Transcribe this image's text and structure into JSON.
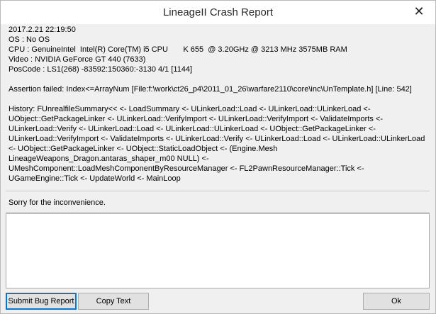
{
  "window": {
    "title": "LineageII Crash Report",
    "close_glyph": "✕"
  },
  "report": {
    "lines_top": [
      "2017.2.21 22:19:50",
      "OS : No OS",
      "CPU : GenuineIntel  Intel(R) Core(TM) i5 CPU       K 655  @ 3.20GHz @ 3213 MHz 3575MB RAM",
      "Video : NVIDIA GeForce GT 440 (7633)",
      "PosCode : LS1(268) -83592:150360:-3130 4/1 [1144]"
    ],
    "assertion": "Assertion failed: Index<=ArrayNum [File:f:\\work\\ct26_p4\\2011_01_26\\warfare2110\\core\\inc\\UnTemplate.h] [Line: 542]",
    "history": "History: FUnrealfileSummary<< <- LoadSummary <- ULinkerLoad::Load <- ULinkerLoad::ULinkerLoad <- UObject::GetPackageLinker <- ULinkerLoad::VerifyImport <- ULinkerLoad::VerifyImport <- ValidateImports <- ULinkerLoad::Verify <- ULinkerLoad::Load <- ULinkerLoad::ULinkerLoad <- UObject::GetPackageLinker <- ULinkerLoad::VerifyImport <- ValidateImports <- ULinkerLoad::Verify <- ULinkerLoad::Load <- ULinkerLoad::ULinkerLoad <- UObject::GetPackageLinker <- UObject::StaticLoadObject <- (Engine.Mesh LineageWeapons_Dragon.antaras_shaper_m00 NULL) <- UMeshComponent::LoadMeshComponentByResourceManager <- FL2PawnResourceManager::Tick <- UGameEngine::Tick <- UpdateWorld <- MainLoop"
  },
  "message": "Sorry for the inconvenience.",
  "comment": {
    "value": "",
    "placeholder": ""
  },
  "buttons": {
    "submit": "Submit Bug Report",
    "copy": "Copy Text",
    "ok": "Ok"
  }
}
